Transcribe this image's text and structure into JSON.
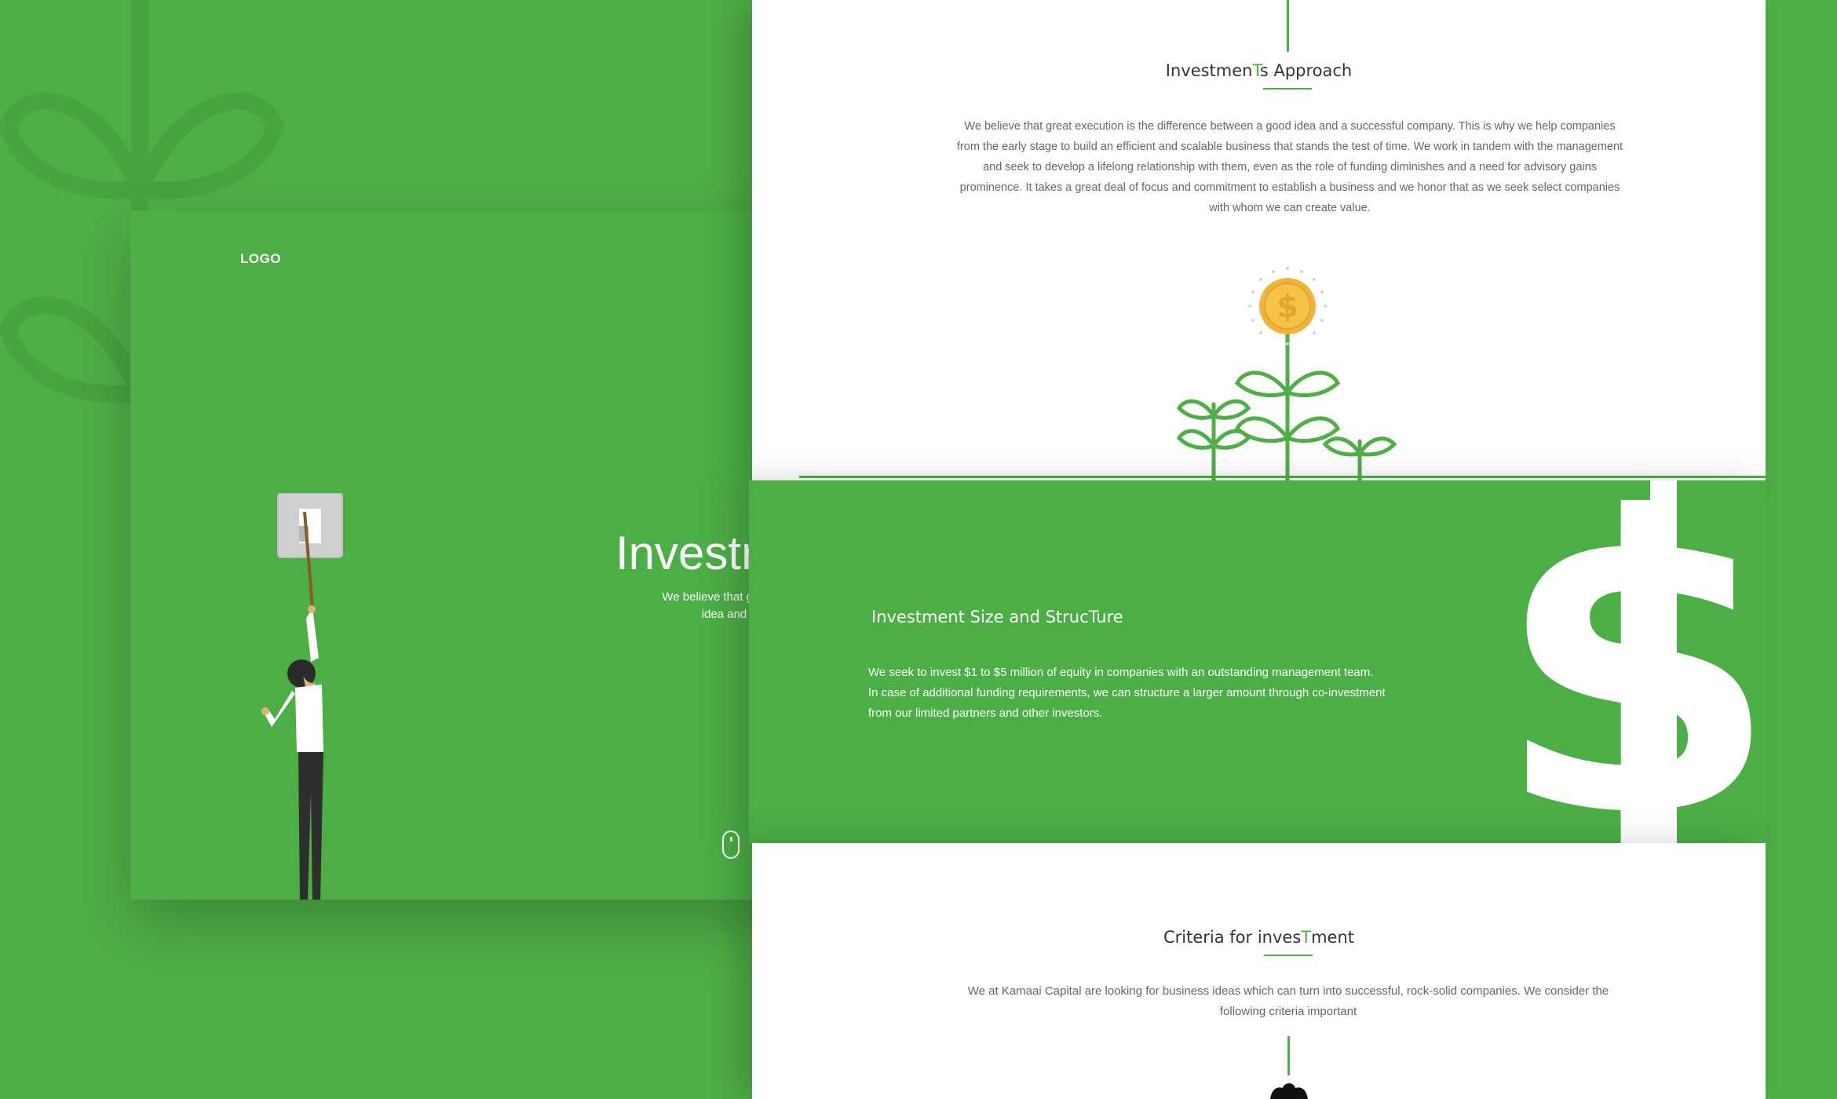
{
  "hero": {
    "logo": "LOGO",
    "title": "Investr",
    "subtitle_line1": "We believe that great execution is t",
    "subtitle_line2": "idea and a successf"
  },
  "approach": {
    "title_pre": "Investmen",
    "title_accent": "T",
    "title_post": "s Approach",
    "body": "We believe that great execution is the difference between a good idea and a successful company. This is why we help companies from the early stage to build an efficient and scalable business that stands the test of time. We work in tandem with the management and seek to develop a lifelong relationship with them, even as the role of funding diminishes and a need for advisory gains prominence. It takes a great deal of focus and commitment to establish a business and we honor that as we seek select companies with whom we can create value.",
    "coin_symbol": "$"
  },
  "size": {
    "title": "Investment Size and StrucTure",
    "line1": "We seek to invest $1 to $5 million of equity in companies with an outstanding management team.",
    "line2": "In case of additional funding requirements, we can structure a larger amount through co-investment",
    "line3": "from our limited partners and other investors.",
    "big_symbol": "$"
  },
  "criteria": {
    "title_pre": "Criteria for inves",
    "title_accent": "T",
    "title_post": "ment",
    "body": "We at Kamaai Capital are looking for business ideas which can turn into successful, rock-solid companies. We consider the following criteria important"
  },
  "colors": {
    "brand_green": "#4faf47",
    "coin_gold": "#f0b43a",
    "text_dark": "#333333"
  }
}
